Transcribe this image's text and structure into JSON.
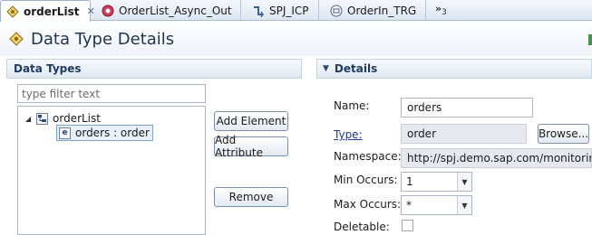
{
  "tabs": [
    {
      "label": "orderList",
      "icon": "data-type-icon",
      "active": true
    },
    {
      "label": "OrderList_Async_Out",
      "icon": "service-interface-icon"
    },
    {
      "label": "SPJ_ICP",
      "icon": "mapping-icon"
    },
    {
      "label": "OrderIn_TRG",
      "icon": "message-type-icon"
    }
  ],
  "tabs_overflow": {
    "symbol": "»",
    "count": "3"
  },
  "header": {
    "title": "Data Type Details"
  },
  "data_types": {
    "title": "Data Types",
    "filter_placeholder": "type filter text",
    "tree": {
      "root": {
        "label": "orderList",
        "icon": "complex-type-icon"
      },
      "child": {
        "icon_letter": "e",
        "label": "orders : order"
      }
    },
    "buttons": {
      "add_element": "Add Element",
      "add_attribute": "Add Attribute",
      "remove": "Remove"
    }
  },
  "details": {
    "title": "Details",
    "name_label": "Name:",
    "name_value": "orders",
    "type_label": "Type:",
    "type_value": "order",
    "browse_label": "Browse...",
    "namespace_label": "Namespace:",
    "namespace_value": "http://spj.demo.sap.com/monitoring",
    "min_occurs_label": "Min Occurs:",
    "min_occurs_value": "1",
    "max_occurs_label": "Max Occurs:",
    "max_occurs_value": "*",
    "deletable_label": "Deletable:",
    "deletable_checked": false
  },
  "colors": {
    "accent": "#1f3b5e",
    "link": "#1f3b8a"
  }
}
